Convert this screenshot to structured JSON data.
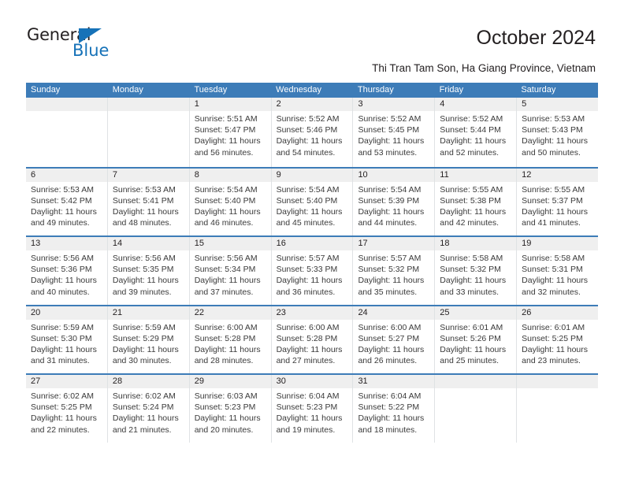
{
  "brand": {
    "name_part1": "General",
    "name_part2": "Blue",
    "triangle_icon": "triangle-logo-icon",
    "accent_color": "#1672b8"
  },
  "header": {
    "title": "October 2024",
    "subtitle": "Thi Tran Tam Son, Ha Giang Province, Vietnam"
  },
  "theme": {
    "header_blue": "#3d7cb8",
    "date_band_gray": "#efefef",
    "cell_border": "#dfe2e4"
  },
  "calendar": {
    "weekday_headers": [
      "Sunday",
      "Monday",
      "Tuesday",
      "Wednesday",
      "Thursday",
      "Friday",
      "Saturday"
    ],
    "weeks": [
      [
        {
          "day": "",
          "empty": true,
          "sunrise": "",
          "sunset": "",
          "daylight1": "",
          "daylight2": ""
        },
        {
          "day": "",
          "empty": true,
          "sunrise": "",
          "sunset": "",
          "daylight1": "",
          "daylight2": ""
        },
        {
          "day": "1",
          "empty": false,
          "sunrise": "Sunrise: 5:51 AM",
          "sunset": "Sunset: 5:47 PM",
          "daylight1": "Daylight: 11 hours",
          "daylight2": "and 56 minutes."
        },
        {
          "day": "2",
          "empty": false,
          "sunrise": "Sunrise: 5:52 AM",
          "sunset": "Sunset: 5:46 PM",
          "daylight1": "Daylight: 11 hours",
          "daylight2": "and 54 minutes."
        },
        {
          "day": "3",
          "empty": false,
          "sunrise": "Sunrise: 5:52 AM",
          "sunset": "Sunset: 5:45 PM",
          "daylight1": "Daylight: 11 hours",
          "daylight2": "and 53 minutes."
        },
        {
          "day": "4",
          "empty": false,
          "sunrise": "Sunrise: 5:52 AM",
          "sunset": "Sunset: 5:44 PM",
          "daylight1": "Daylight: 11 hours",
          "daylight2": "and 52 minutes."
        },
        {
          "day": "5",
          "empty": false,
          "sunrise": "Sunrise: 5:53 AM",
          "sunset": "Sunset: 5:43 PM",
          "daylight1": "Daylight: 11 hours",
          "daylight2": "and 50 minutes."
        }
      ],
      [
        {
          "day": "6",
          "empty": false,
          "sunrise": "Sunrise: 5:53 AM",
          "sunset": "Sunset: 5:42 PM",
          "daylight1": "Daylight: 11 hours",
          "daylight2": "and 49 minutes."
        },
        {
          "day": "7",
          "empty": false,
          "sunrise": "Sunrise: 5:53 AM",
          "sunset": "Sunset: 5:41 PM",
          "daylight1": "Daylight: 11 hours",
          "daylight2": "and 48 minutes."
        },
        {
          "day": "8",
          "empty": false,
          "sunrise": "Sunrise: 5:54 AM",
          "sunset": "Sunset: 5:40 PM",
          "daylight1": "Daylight: 11 hours",
          "daylight2": "and 46 minutes."
        },
        {
          "day": "9",
          "empty": false,
          "sunrise": "Sunrise: 5:54 AM",
          "sunset": "Sunset: 5:40 PM",
          "daylight1": "Daylight: 11 hours",
          "daylight2": "and 45 minutes."
        },
        {
          "day": "10",
          "empty": false,
          "sunrise": "Sunrise: 5:54 AM",
          "sunset": "Sunset: 5:39 PM",
          "daylight1": "Daylight: 11 hours",
          "daylight2": "and 44 minutes."
        },
        {
          "day": "11",
          "empty": false,
          "sunrise": "Sunrise: 5:55 AM",
          "sunset": "Sunset: 5:38 PM",
          "daylight1": "Daylight: 11 hours",
          "daylight2": "and 42 minutes."
        },
        {
          "day": "12",
          "empty": false,
          "sunrise": "Sunrise: 5:55 AM",
          "sunset": "Sunset: 5:37 PM",
          "daylight1": "Daylight: 11 hours",
          "daylight2": "and 41 minutes."
        }
      ],
      [
        {
          "day": "13",
          "empty": false,
          "sunrise": "Sunrise: 5:56 AM",
          "sunset": "Sunset: 5:36 PM",
          "daylight1": "Daylight: 11 hours",
          "daylight2": "and 40 minutes."
        },
        {
          "day": "14",
          "empty": false,
          "sunrise": "Sunrise: 5:56 AM",
          "sunset": "Sunset: 5:35 PM",
          "daylight1": "Daylight: 11 hours",
          "daylight2": "and 39 minutes."
        },
        {
          "day": "15",
          "empty": false,
          "sunrise": "Sunrise: 5:56 AM",
          "sunset": "Sunset: 5:34 PM",
          "daylight1": "Daylight: 11 hours",
          "daylight2": "and 37 minutes."
        },
        {
          "day": "16",
          "empty": false,
          "sunrise": "Sunrise: 5:57 AM",
          "sunset": "Sunset: 5:33 PM",
          "daylight1": "Daylight: 11 hours",
          "daylight2": "and 36 minutes."
        },
        {
          "day": "17",
          "empty": false,
          "sunrise": "Sunrise: 5:57 AM",
          "sunset": "Sunset: 5:32 PM",
          "daylight1": "Daylight: 11 hours",
          "daylight2": "and 35 minutes."
        },
        {
          "day": "18",
          "empty": false,
          "sunrise": "Sunrise: 5:58 AM",
          "sunset": "Sunset: 5:32 PM",
          "daylight1": "Daylight: 11 hours",
          "daylight2": "and 33 minutes."
        },
        {
          "day": "19",
          "empty": false,
          "sunrise": "Sunrise: 5:58 AM",
          "sunset": "Sunset: 5:31 PM",
          "daylight1": "Daylight: 11 hours",
          "daylight2": "and 32 minutes."
        }
      ],
      [
        {
          "day": "20",
          "empty": false,
          "sunrise": "Sunrise: 5:59 AM",
          "sunset": "Sunset: 5:30 PM",
          "daylight1": "Daylight: 11 hours",
          "daylight2": "and 31 minutes."
        },
        {
          "day": "21",
          "empty": false,
          "sunrise": "Sunrise: 5:59 AM",
          "sunset": "Sunset: 5:29 PM",
          "daylight1": "Daylight: 11 hours",
          "daylight2": "and 30 minutes."
        },
        {
          "day": "22",
          "empty": false,
          "sunrise": "Sunrise: 6:00 AM",
          "sunset": "Sunset: 5:28 PM",
          "daylight1": "Daylight: 11 hours",
          "daylight2": "and 28 minutes."
        },
        {
          "day": "23",
          "empty": false,
          "sunrise": "Sunrise: 6:00 AM",
          "sunset": "Sunset: 5:28 PM",
          "daylight1": "Daylight: 11 hours",
          "daylight2": "and 27 minutes."
        },
        {
          "day": "24",
          "empty": false,
          "sunrise": "Sunrise: 6:00 AM",
          "sunset": "Sunset: 5:27 PM",
          "daylight1": "Daylight: 11 hours",
          "daylight2": "and 26 minutes."
        },
        {
          "day": "25",
          "empty": false,
          "sunrise": "Sunrise: 6:01 AM",
          "sunset": "Sunset: 5:26 PM",
          "daylight1": "Daylight: 11 hours",
          "daylight2": "and 25 minutes."
        },
        {
          "day": "26",
          "empty": false,
          "sunrise": "Sunrise: 6:01 AM",
          "sunset": "Sunset: 5:25 PM",
          "daylight1": "Daylight: 11 hours",
          "daylight2": "and 23 minutes."
        }
      ],
      [
        {
          "day": "27",
          "empty": false,
          "sunrise": "Sunrise: 6:02 AM",
          "sunset": "Sunset: 5:25 PM",
          "daylight1": "Daylight: 11 hours",
          "daylight2": "and 22 minutes."
        },
        {
          "day": "28",
          "empty": false,
          "sunrise": "Sunrise: 6:02 AM",
          "sunset": "Sunset: 5:24 PM",
          "daylight1": "Daylight: 11 hours",
          "daylight2": "and 21 minutes."
        },
        {
          "day": "29",
          "empty": false,
          "sunrise": "Sunrise: 6:03 AM",
          "sunset": "Sunset: 5:23 PM",
          "daylight1": "Daylight: 11 hours",
          "daylight2": "and 20 minutes."
        },
        {
          "day": "30",
          "empty": false,
          "sunrise": "Sunrise: 6:04 AM",
          "sunset": "Sunset: 5:23 PM",
          "daylight1": "Daylight: 11 hours",
          "daylight2": "and 19 minutes."
        },
        {
          "day": "31",
          "empty": false,
          "sunrise": "Sunrise: 6:04 AM",
          "sunset": "Sunset: 5:22 PM",
          "daylight1": "Daylight: 11 hours",
          "daylight2": "and 18 minutes."
        },
        {
          "day": "",
          "empty": true,
          "sunrise": "",
          "sunset": "",
          "daylight1": "",
          "daylight2": ""
        },
        {
          "day": "",
          "empty": true,
          "sunrise": "",
          "sunset": "",
          "daylight1": "",
          "daylight2": ""
        }
      ]
    ]
  }
}
